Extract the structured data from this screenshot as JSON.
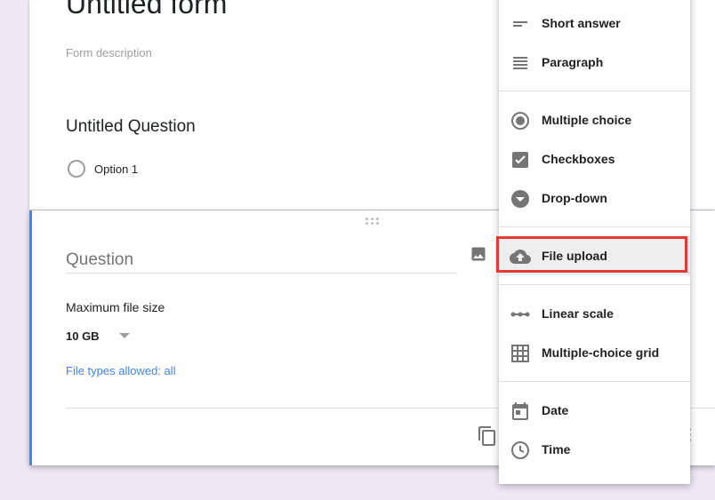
{
  "form": {
    "title": "Untitled form",
    "description_placeholder": "Form description"
  },
  "question1": {
    "title": "Untitled Question",
    "option_label": "Option 1"
  },
  "active_question": {
    "question_placeholder": "Question",
    "max_file_size_label": "Maximum file size",
    "max_file_size_value": "10 GB",
    "file_types_link": "File types allowed: all"
  },
  "menu": {
    "items": [
      {
        "label": "Short answer",
        "icon": "short-answer-icon"
      },
      {
        "label": "Paragraph",
        "icon": "paragraph-icon"
      },
      {
        "label": "Multiple choice",
        "icon": "radio-button-icon"
      },
      {
        "label": "Checkboxes",
        "icon": "checkbox-icon"
      },
      {
        "label": "Drop-down",
        "icon": "dropdown-circle-icon"
      },
      {
        "label": "File upload",
        "icon": "cloud-upload-icon"
      },
      {
        "label": "Linear scale",
        "icon": "linear-scale-icon"
      },
      {
        "label": "Multiple-choice grid",
        "icon": "grid-icon"
      },
      {
        "label": "Date",
        "icon": "calendar-icon"
      },
      {
        "label": "Time",
        "icon": "clock-icon"
      }
    ],
    "selected": "File upload"
  },
  "colors": {
    "accent": "#4285f4",
    "background": "#ede7f6",
    "highlight": "#e53935",
    "icon_gray": "#757575"
  }
}
